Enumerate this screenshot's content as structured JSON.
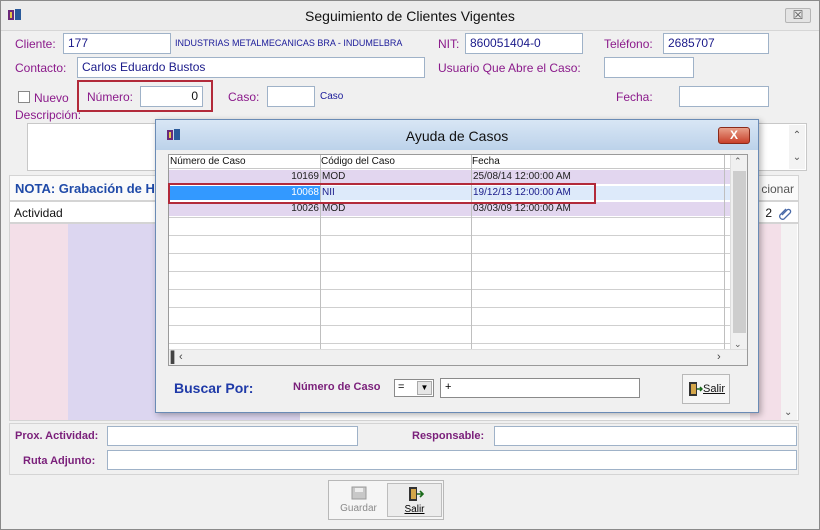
{
  "window": {
    "title": "Seguimiento de Clientes Vigentes",
    "close": "☒"
  },
  "form": {
    "cliente_label": "Cliente:",
    "cliente_code": "177",
    "cliente_name": "INDUSTRIAS METALMECANICAS BRA - INDUMELBRA",
    "nit_label": "NIT:",
    "nit_value": "860051404-0",
    "telefono_label": "Teléfono:",
    "telefono_value": "2685707",
    "contacto_label": "Contacto:",
    "contacto_value": "Carlos Eduardo Bustos",
    "usuario_label": "Usuario Que Abre el Caso:",
    "usuario_value": "",
    "nuevo_label": "Nuevo",
    "numero_label": "Número:",
    "numero_value": "0",
    "caso_label": "Caso:",
    "caso_value": "",
    "caso_text": "Caso",
    "fecha_label": "Fecha:",
    "fecha_value": "",
    "descripcion_label": "Descripción:",
    "nota_text": "NOTA: Grabación de H",
    "nota_right": "cionar",
    "actividad_label": "Actividad",
    "actividad_right": "2",
    "prox_actividad_label": "Prox. Actividad:",
    "responsable_label": "Responsable:",
    "ruta_adjunto_label": "Ruta Adjunto:"
  },
  "toolbar": {
    "guardar_label": "Guardar",
    "salir_label": "Salir"
  },
  "dialog": {
    "title": "Ayuda de Casos",
    "close": "X",
    "columns": [
      "Número de Caso",
      "Código del Caso",
      "Fecha"
    ],
    "rows": [
      {
        "numero": "10169",
        "codigo": "MOD",
        "fecha": "25/08/14 12:00:00 AM"
      },
      {
        "numero": "10068",
        "codigo": "NII",
        "fecha": "19/12/13 12:00:00 AM"
      },
      {
        "numero": "10026",
        "codigo": "MOD",
        "fecha": "03/03/09 12:00:00 AM"
      }
    ],
    "buscar_label": "Buscar  Por:",
    "search_field_label": "Número de Caso",
    "operator": "=",
    "search_value": "+",
    "salir_label": "Salir"
  },
  "colors": {
    "label": "#8b1a8b",
    "value": "#1a1a8a",
    "highlight": "#b22a3a",
    "selected_row": "#3399ff"
  }
}
